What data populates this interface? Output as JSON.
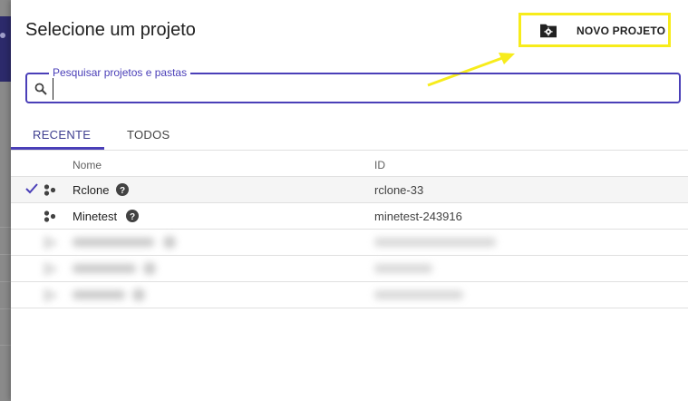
{
  "dialog": {
    "title": "Selecione um projeto",
    "new_project_label": "NOVO PROJETO"
  },
  "search": {
    "label": "Pesquisar projetos e pastas",
    "value": "",
    "placeholder": ""
  },
  "tabs": [
    {
      "label": "RECENTE",
      "active": true
    },
    {
      "label": "TODOS",
      "active": false
    }
  ],
  "columns": {
    "name": "Nome",
    "id": "ID"
  },
  "rows": [
    {
      "name": "Rclone",
      "id": "rclone-33",
      "selected": true
    },
    {
      "name": "Minetest",
      "id": "minetest-243916",
      "selected": false
    }
  ],
  "colors": {
    "accent": "#4a3fb8",
    "highlight_box": "#f7ec1b",
    "annotation_arrow": "#f7ec1b"
  },
  "icons": [
    "folder-settings-icon",
    "search-icon",
    "check-icon",
    "project-icon",
    "help-icon"
  ]
}
